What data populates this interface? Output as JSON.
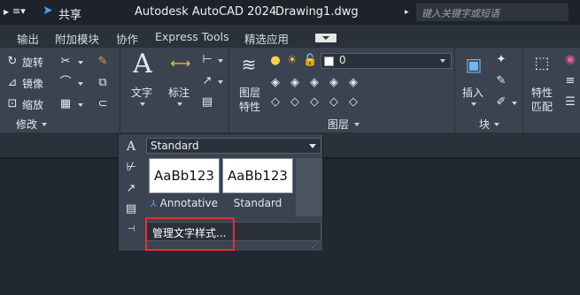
{
  "titlebar": {
    "share_label": "共享",
    "title": "Autodesk AutoCAD 2024",
    "document": "Drawing1.dwg",
    "search_placeholder": "键入关键字或短语"
  },
  "ribbon_tabs": [
    "输出",
    "附加模块",
    "协作",
    "Express Tools",
    "精选应用"
  ],
  "modify_panel": {
    "rotate": "旋转",
    "mirror": "镜像",
    "scale": "缩放",
    "title": "修改"
  },
  "annotation_panel": {
    "text": "文字",
    "dimension": "标注"
  },
  "layers_panel": {
    "properties_line1": "图层",
    "properties_line2": "特性",
    "current_layer": "0",
    "title": "图层"
  },
  "block_panel": {
    "insert": "插入",
    "title": "块"
  },
  "properties_panel": {
    "match_line1": "特性",
    "match_line2": "匹配"
  },
  "text_style_flyout": {
    "current_style": "Standard",
    "gallery": [
      {
        "sample": "AaBb123",
        "name": "Annotative",
        "annotative": true
      },
      {
        "sample": "AaBb123",
        "name": "Standard",
        "annotative": false
      }
    ],
    "manage_label": "管理文字样式..."
  },
  "colors": {
    "highlight": "#e0332b",
    "annotative_icon": "#5aa0e6"
  }
}
